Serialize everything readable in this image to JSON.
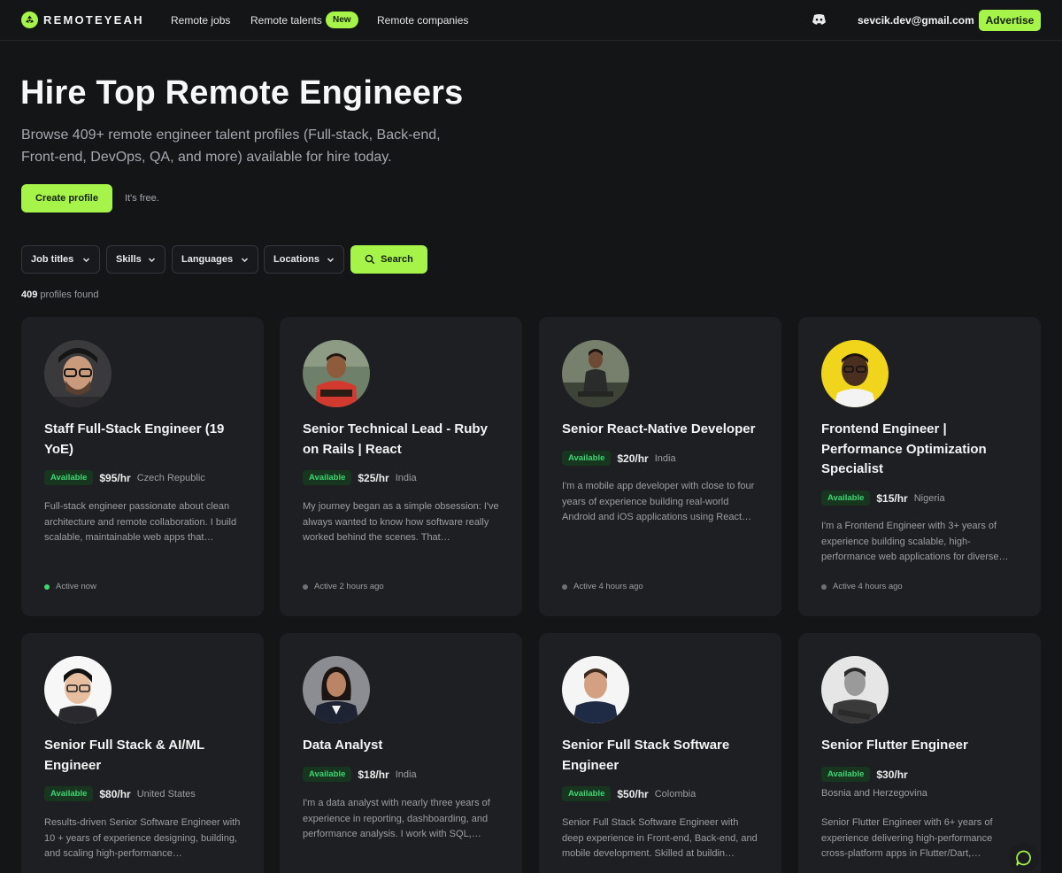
{
  "nav": {
    "logo_text": "REMOTEYEAH",
    "links": [
      "Remote jobs",
      "Remote talents",
      "Remote companies"
    ],
    "new_badge": "New",
    "user_email": "sevcik.dev@gmail.com",
    "advertise_label": "Advertise"
  },
  "hero": {
    "title": "Hire Top Remote Engineers",
    "subtitle": "Browse 409+ remote engineer talent profiles (Full-stack, Back-end, Front-end, DevOps, QA, and more) available for hire today.",
    "create_label": "Create profile",
    "free_note": "It's free."
  },
  "filters": {
    "items": [
      "Job titles",
      "Skills",
      "Languages",
      "Locations"
    ],
    "search_label": "Search"
  },
  "results": {
    "count": "409",
    "suffix": "profiles found"
  },
  "profiles": [
    {
      "title": "Staff Full-Stack Engineer (19 YoE)",
      "status": "Available",
      "rate": "$95/hr",
      "location": "Czech Republic",
      "description": "Full-stack engineer passionate about clean architecture and remote collaboration. I build scalable, maintainable web apps that…",
      "activity": "Active now"
    },
    {
      "title": "Senior Technical Lead - Ruby on Rails | React",
      "status": "Available",
      "rate": "$25/hr",
      "location": "India",
      "description": "My journey began as a simple obsession: I've always wanted to know how software really worked behind the scenes. That…",
      "activity": "Active 2 hours ago"
    },
    {
      "title": "Senior React-Native Developer",
      "status": "Available",
      "rate": "$20/hr",
      "location": "India",
      "description": "I'm a mobile app developer with close to four years of experience building real-world Android and iOS applications using React…",
      "activity": "Active 4 hours ago"
    },
    {
      "title": "Frontend Engineer | Performance Optimization Specialist",
      "status": "Available",
      "rate": "$15/hr",
      "location": "Nigeria",
      "description": "I'm a Frontend Engineer with 3+ years of experience building scalable, high-performance web applications for diverse…",
      "activity": "Active 4 hours ago"
    },
    {
      "title": "Senior Full Stack & AI/ML Engineer",
      "status": "Available",
      "rate": "$80/hr",
      "location": "United States",
      "description": "Results-driven Senior Software Engineer with 10 + years of experience designing, building, and scaling high-performance…",
      "activity": ""
    },
    {
      "title": "Data Analyst",
      "status": "Available",
      "rate": "$18/hr",
      "location": "India",
      "description": "I'm a data analyst with nearly three years of experience in reporting, dashboarding, and performance analysis. I work with SQL,…",
      "activity": ""
    },
    {
      "title": "Senior Full Stack Software Engineer",
      "status": "Available",
      "rate": "$50/hr",
      "location": "Colombia",
      "description": "Senior Full Stack Software Engineer with deep experience in Front-end, Back-end, and mobile development. Skilled at buildin…",
      "activity": ""
    },
    {
      "title": "Senior Flutter Engineer",
      "status": "Available",
      "rate": "$30/hr",
      "location": "Bosnia and Herzegovina",
      "description": "Senior Flutter Engineer with 6+ years of experience delivering high-performance cross-platform apps in Flutter/Dart,…",
      "activity": ""
    }
  ],
  "icons": {
    "logo": "recycle-logo-icon",
    "discord": "discord-icon",
    "chevron": "chevron-down-icon",
    "search": "search-icon",
    "chat": "chat-bubble-icon"
  },
  "colors": {
    "accent": "#a6f34a",
    "background": "#141517",
    "card": "#1e1f22",
    "available": "#3fd672"
  }
}
